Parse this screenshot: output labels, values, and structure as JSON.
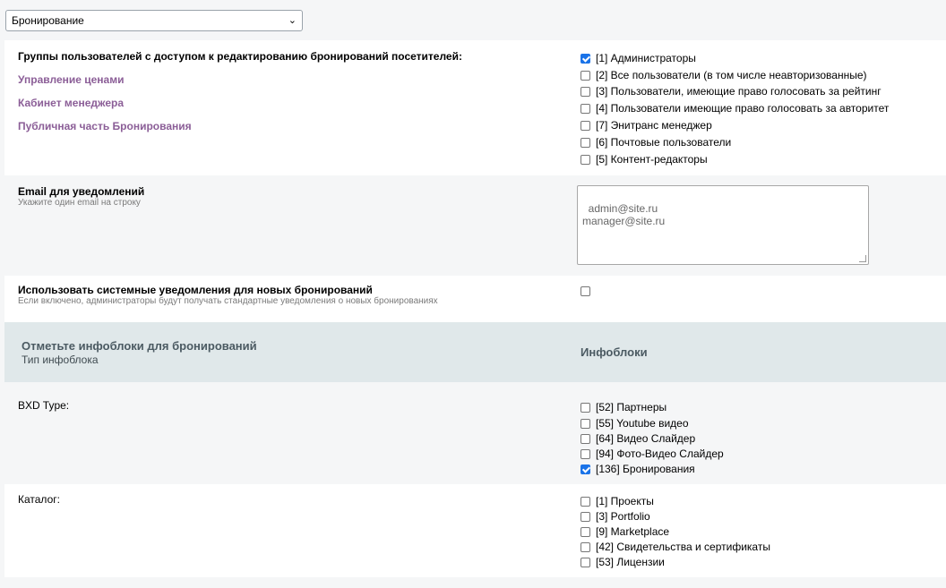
{
  "top_select": {
    "value": "Бронирование"
  },
  "groups": {
    "title": "Группы пользователей с доступом к редактированию бронирований посетителей:",
    "links": [
      "Управление ценами",
      "Кабинет менеджера",
      "Публичная часть Бронирования"
    ],
    "options": [
      {
        "label": "[1] Администраторы",
        "checked": true
      },
      {
        "label": "[2] Все пользователи (в том числе неавторизованные)",
        "checked": false
      },
      {
        "label": "[3] Пользователи, имеющие право голосовать за рейтинг",
        "checked": false
      },
      {
        "label": "[4] Пользователи имеющие право голосовать за авторитет",
        "checked": false
      },
      {
        "label": "[7] Энитранс менеджер",
        "checked": false
      },
      {
        "label": "[6] Почтовые пользователи",
        "checked": false
      },
      {
        "label": "[5] Контент-редакторы",
        "checked": false
      }
    ]
  },
  "email": {
    "label": "Email для уведомлений",
    "hint": "Укажите один email на строку",
    "value": "admin@site.ru\nmanager@site.ru"
  },
  "system_notify": {
    "label": "Использовать системные уведомления для новых бронирований",
    "hint": "Если включено, администраторы будут получать стандартные уведомления о новых бронированиях",
    "checked": false
  },
  "iblocks_header": {
    "title": "Отметьте инфоблоки для бронирований",
    "subtitle": "Тип инфоблока",
    "right": "Инфоблоки"
  },
  "bxd": {
    "label": "BXD Type:",
    "options": [
      {
        "label": "[52] Партнеры",
        "checked": false
      },
      {
        "label": "[55] Youtube видео",
        "checked": false
      },
      {
        "label": "[64] Видео Слайдер",
        "checked": false
      },
      {
        "label": "[94] Фото-Видео Слайдер",
        "checked": false
      },
      {
        "label": "[136] Бронирования",
        "checked": true
      }
    ]
  },
  "catalog": {
    "label": "Каталог:",
    "options": [
      {
        "label": "[1] Проекты",
        "checked": false
      },
      {
        "label": "[3] Portfolio",
        "checked": false
      },
      {
        "label": "[9] Marketplace",
        "checked": false
      },
      {
        "label": "[42] Свидетельства и сертификаты",
        "checked": false
      },
      {
        "label": "[53] Лицензии",
        "checked": false
      }
    ]
  }
}
